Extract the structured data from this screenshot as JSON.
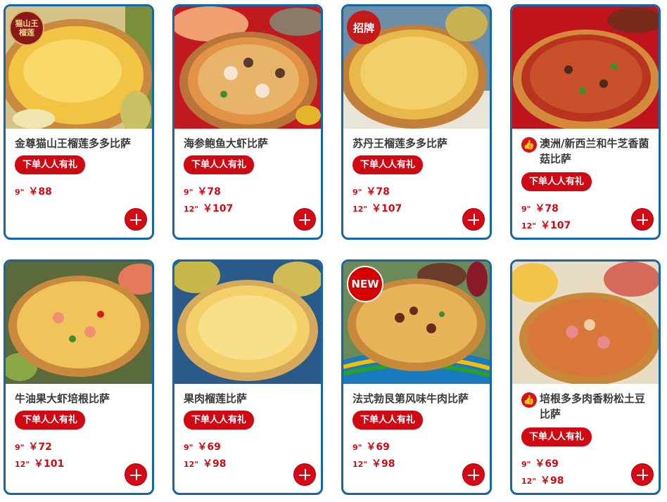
{
  "promo_label": "下单人人有礼",
  "add_icon": "plus-circle-icon",
  "like_icon": "thumbs-up-icon",
  "products": [
    {
      "name": "金尊猫山王榴莲多多比萨",
      "badge": "猫山王 榴莲",
      "badge_kind": "logo",
      "prices": [
        {
          "size": "9\"",
          "price": "￥88"
        }
      ]
    },
    {
      "name": "海参鲍鱼大虾比萨",
      "badge": "",
      "badge_kind": "",
      "prices": [
        {
          "size": "9\"",
          "price": "￥78"
        },
        {
          "size": "12\"",
          "price": "￥107"
        }
      ]
    },
    {
      "name": "苏丹王榴莲多多比萨",
      "badge": "招牌",
      "badge_kind": "sign",
      "prices": [
        {
          "size": "9\"",
          "price": "￥78"
        },
        {
          "size": "12\"",
          "price": "￥107"
        }
      ]
    },
    {
      "name": "澳洲/新西兰和牛芝香菌菇比萨",
      "badge": "",
      "badge_kind": "",
      "liked": true,
      "prices": [
        {
          "size": "9\"",
          "price": "￥78"
        },
        {
          "size": "12\"",
          "price": "￥107"
        }
      ]
    },
    {
      "name": "牛油果大虾培根比萨",
      "badge": "",
      "badge_kind": "",
      "prices": [
        {
          "size": "9\"",
          "price": "￥72"
        },
        {
          "size": "12\"",
          "price": "￥101"
        }
      ]
    },
    {
      "name": "果肉榴莲比萨",
      "badge": "",
      "badge_kind": "",
      "prices": [
        {
          "size": "9\"",
          "price": "￥69"
        },
        {
          "size": "12\"",
          "price": "￥98"
        }
      ]
    },
    {
      "name": "法式勃艮第风味牛肉比萨",
      "badge": "NEW",
      "badge_kind": "new",
      "prices": [
        {
          "size": "9\"",
          "price": "￥69"
        },
        {
          "size": "12\"",
          "price": "￥98"
        }
      ]
    },
    {
      "name": "培根多多肉香粉松土豆比萨",
      "badge": "",
      "badge_kind": "",
      "liked": true,
      "prices": [
        {
          "size": "9\"",
          "price": "￥69"
        },
        {
          "size": "12\"",
          "price": "￥98"
        }
      ]
    }
  ],
  "colors": {
    "border": "#1565a8",
    "accent": "#cf0a15"
  }
}
